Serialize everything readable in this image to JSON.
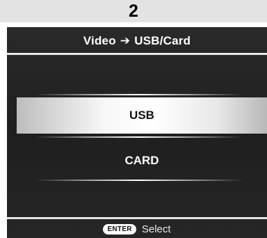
{
  "step_number": "2",
  "menu": {
    "title_left": "Video",
    "arrow_glyph": "➔",
    "title_right": "USB/Card",
    "items": [
      {
        "label": "USB",
        "selected": true
      },
      {
        "label": "CARD",
        "selected": false
      }
    ]
  },
  "footer": {
    "enter_key": "ENTER",
    "action": "Select"
  }
}
